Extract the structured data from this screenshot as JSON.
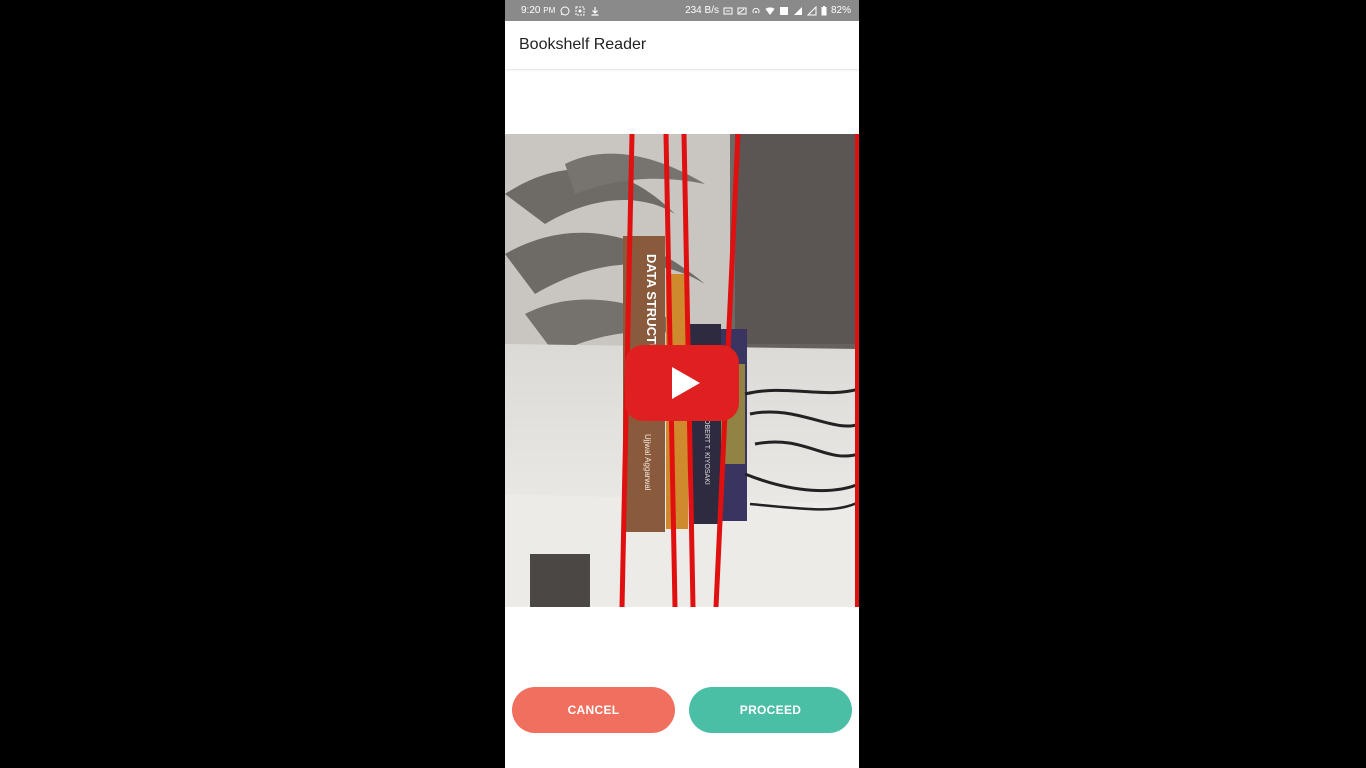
{
  "status_bar": {
    "time": "9:20",
    "ampm": "PM",
    "network_speed": "234 B/s",
    "battery": "82%",
    "icons": [
      "whatsapp-icon",
      "screenshot-icon",
      "download-icon",
      "vpn-key-icon",
      "cast-icon",
      "hotspot-icon",
      "wifi-icon",
      "volte-icon",
      "signal-icon",
      "battery-icon"
    ]
  },
  "app_bar": {
    "title": "Bookshelf Reader"
  },
  "preview": {
    "book_spines": [
      "DATA STRUCTURE",
      "Ujjwal Aggarwal",
      "ROBERT T. KIYOSAKI"
    ],
    "play_icon": "play-icon"
  },
  "actions": {
    "cancel_label": "CANCEL",
    "proceed_label": "PROCEED"
  },
  "colors": {
    "cancel": "#f06f5e",
    "proceed": "#4bbfa6",
    "segment_line": "#e01010",
    "play_button": "#e02020"
  }
}
